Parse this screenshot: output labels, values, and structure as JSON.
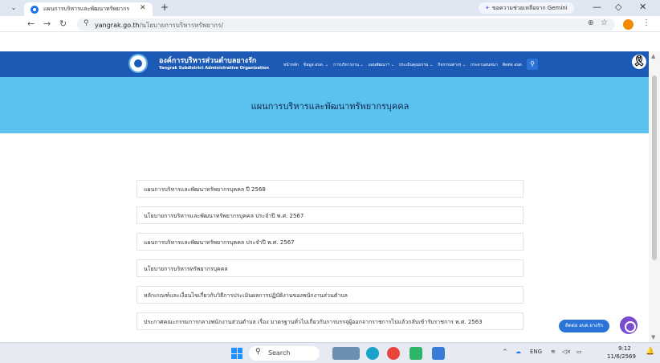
{
  "browser": {
    "tab_title": "แผนการบริหารและพัฒนาทรัพยากร",
    "tab_close": "✕",
    "new_tab": "+",
    "gemini_label": "ขอความช่วยเหลือจาก Gemini",
    "url_host": "yangrak.go.th",
    "url_path": "/นโยบายการบริหารทรัพยากร/",
    "window_controls": [
      "—",
      "◇",
      "✕"
    ]
  },
  "site": {
    "org_name": "องค์การบริหารส่วนตำบลยางรัก",
    "org_subtitle": "Yangrak Subdistrict Administrative Organization",
    "nav": [
      "หน้าหลัก",
      "ข้อมูล อบต. ⌄",
      "การบริหารงาน ⌄",
      "แผนพัฒนาฯ ⌄",
      "ประเมินคุณธรรม ⌄",
      "กิจกรรมต่างๆ ⌄",
      "กระดานสนทนา",
      "ติดต่อ อบต."
    ],
    "search_icon": "search-icon",
    "ribbon_icon": "black-ribbon-icon"
  },
  "page": {
    "title": "แผนการบริหารและพัฒนาทรัพยากรบุคคล"
  },
  "documents": [
    "แผนการบริหารและพัฒนาทรัพยากรบุคคล ปี 2568",
    "นโยบายการบริหารและพัฒนาทรัพยากรบุคคล ประจำปี พ.ศ. 2567",
    "แผนการบริหารและพัฒนาทรัพยากรบุคคล ประจำปี พ.ศ. 2567",
    "นโยบายการบริหารทรัพยากรบุคคล",
    "หลักเกณฑ์และเงื่อนไขเกี่ยวกับวิธีการประเมินผลการปฏิบัติงานของพนักงานส่วนตำบล",
    "ประกาศคณะกรรมการกลางพนักงานส่วนตำบล เรื่อง มาตรฐานทั่วไปเกี่ยวกับการบรรจุผู้ออกจากราชการไปแล้วกลับเข้ารับราชการ พ.ศ. 2563"
  ],
  "chat": {
    "label": "ติดต่อ อบต.ยางรัก"
  },
  "taskbar": {
    "search_placeholder": "Search",
    "language": "ENG",
    "time": "9:12",
    "date": "11/6/2569"
  }
}
